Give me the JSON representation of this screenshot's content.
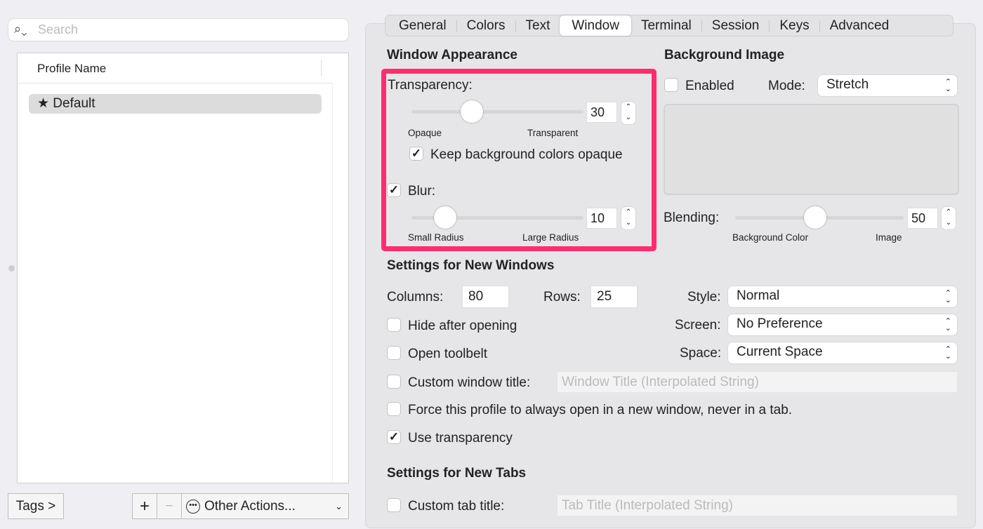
{
  "search": {
    "placeholder": "Search"
  },
  "profiles": {
    "column": "Profile Name",
    "items": [
      {
        "label": "★ Default"
      }
    ]
  },
  "bottom": {
    "tags": "Tags >",
    "add": "+",
    "remove": "−",
    "other": "Other Actions..."
  },
  "tabs": [
    "General",
    "Colors",
    "Text",
    "Window",
    "Terminal",
    "Session",
    "Keys",
    "Advanced"
  ],
  "selected_tab": "Window",
  "appearance": {
    "title": "Window Appearance",
    "transparency_label": "Transparency:",
    "transparency": 30,
    "opaque": "Opaque",
    "transparent": "Transparent",
    "keep_bg": "Keep background colors opaque",
    "keep_bg_checked": true,
    "blur_label": "Blur:",
    "blur_checked": true,
    "blur": 10,
    "small": "Small Radius",
    "large": "Large Radius",
    "highlight_color": "#ff2d6f"
  },
  "bgimage": {
    "title": "Background Image",
    "enabled": "Enabled",
    "mode_label": "Mode:",
    "mode": "Stretch",
    "blending_label": "Blending:",
    "blending": 50,
    "bgcolor": "Background Color",
    "image": "Image"
  },
  "newwin": {
    "title": "Settings for New Windows",
    "columns_label": "Columns:",
    "columns": "80",
    "rows_label": "Rows:",
    "rows": "25",
    "style_label": "Style:",
    "style": "Normal",
    "screen_label": "Screen:",
    "screen": "No Preference",
    "space_label": "Space:",
    "space": "Current Space",
    "hide": "Hide after opening",
    "toolbelt": "Open toolbelt",
    "custom_title": "Custom window title:",
    "title_placeholder": "Window Title (Interpolated String)",
    "force": "Force this profile to always open in a new window, never in a tab.",
    "use_transparency": "Use transparency"
  },
  "newtabs": {
    "title": "Settings for New Tabs",
    "custom_tab": "Custom tab title:",
    "tab_placeholder": "Tab Title (Interpolated String)"
  }
}
